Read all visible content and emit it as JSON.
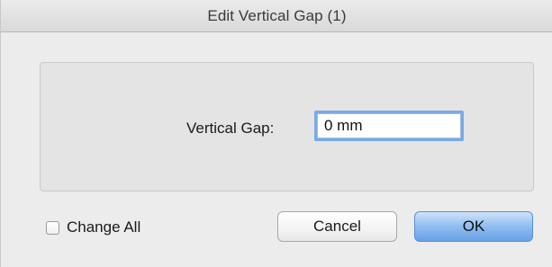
{
  "window": {
    "title": "Edit Vertical Gap (1)"
  },
  "form": {
    "vertical_gap_label": "Vertical Gap:",
    "vertical_gap_value": "0 mm"
  },
  "options": {
    "change_all_label": "Change All",
    "change_all_checked": false
  },
  "buttons": {
    "cancel_label": "Cancel",
    "ok_label": "OK"
  },
  "colors": {
    "default_button_accent": "#6aa2e6",
    "focus_ring": "#7aa9e5"
  }
}
